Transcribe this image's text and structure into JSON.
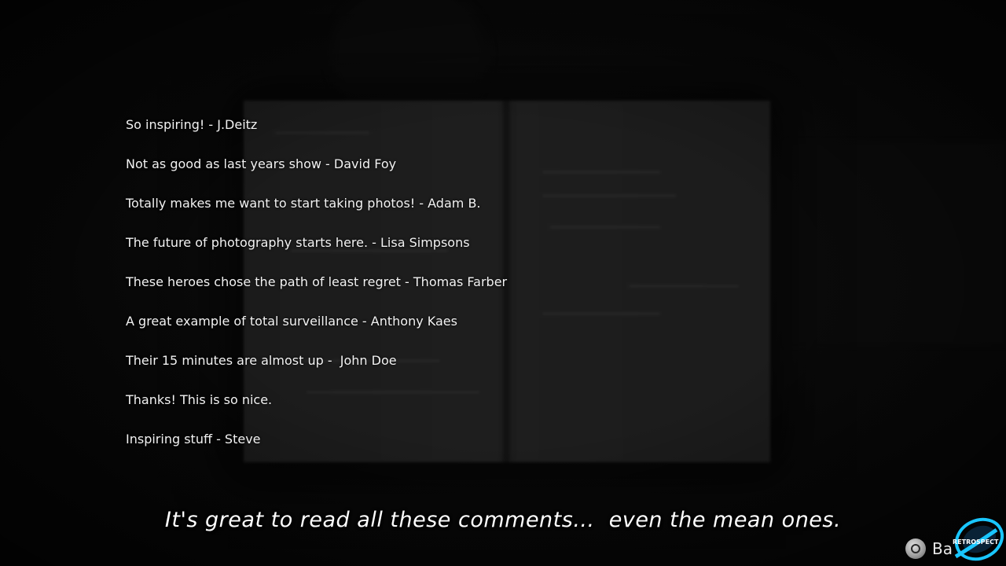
{
  "comments": [
    "So inspiring! - J.Deitz",
    "Not as good as last years show - David Foy",
    "Totally makes me want to start taking photos! - Adam B.",
    "The future of photography starts here. - Lisa Simpsons",
    "These heroes chose the path of least regret - Thomas Farber",
    "A great example of total surveillance - Anthony Kaes",
    "Their 15 minutes are almost up -  John Doe",
    "Thanks! This is so nice.",
    "Inspiring stuff - Steve"
  ],
  "subtitle": "It's great to read all these comments...  even the mean ones.",
  "back_prompt": {
    "button_icon": "circle-button-icon",
    "label": "Ba"
  },
  "watermark": {
    "icon": "retro-logo-icon",
    "text": "RETROSPECT",
    "accent_color": "#19c6ff"
  },
  "colors": {
    "text": "#f2f2f2",
    "background": "#0b0b0b"
  }
}
